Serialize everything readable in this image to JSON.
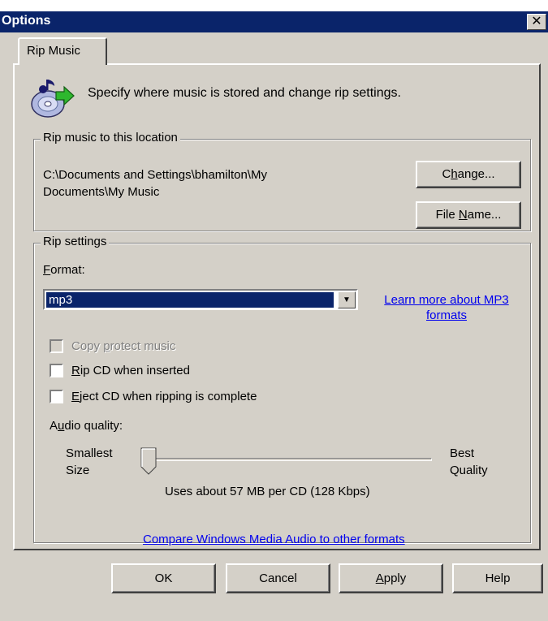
{
  "window": {
    "title": "Options",
    "close_glyph": "✕"
  },
  "tabs": [
    {
      "label": "Rip Music"
    }
  ],
  "header": {
    "icon": "cd-rip-icon",
    "text": "Specify where music is stored and change rip settings."
  },
  "location": {
    "legend": "Rip music to this location",
    "path": "C:\\Documents and Settings\\bhamilton\\My Documents\\My Music",
    "change_button": {
      "before": "C",
      "key": "h",
      "after": "ange..."
    },
    "filename_button": {
      "before": "File ",
      "key": "N",
      "after": "ame..."
    }
  },
  "rip_settings": {
    "legend": "Rip settings",
    "format_label": {
      "before": "",
      "key": "F",
      "after": "ormat:"
    },
    "format_value": "mp3",
    "learn_link": "Learn more about MP3 formats",
    "copy_protect": {
      "before": "Copy ",
      "key": "p",
      "after": "rotect music",
      "checked": false,
      "enabled": false
    },
    "rip_on_insert": {
      "before": "",
      "key": "R",
      "after": "ip CD when inserted",
      "checked": false,
      "enabled": true
    },
    "eject_after": {
      "before": "",
      "key": "E",
      "after": "ject CD when ripping is complete",
      "checked": false,
      "enabled": true
    },
    "audio_quality_label": {
      "before": "A",
      "key": "u",
      "after": "dio quality:"
    },
    "smallest_label": "Smallest Size",
    "best_label": "Best Quality",
    "quality_level": 0,
    "size_text": "Uses about 57 MB per CD (128 Kbps)",
    "compare_link": "Compare Windows Media Audio to other formats"
  },
  "buttons": {
    "ok": "OK",
    "cancel": "Cancel",
    "apply": {
      "before": "",
      "key": "A",
      "after": "pply"
    },
    "help": "Help"
  },
  "colors": {
    "titlebar": "#0a246a",
    "face": "#d4d0c8",
    "link": "#0000ee",
    "selection": "#0a246a"
  }
}
